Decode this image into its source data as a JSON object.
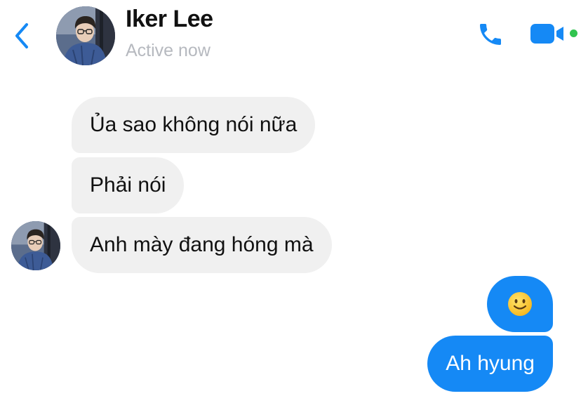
{
  "header": {
    "contact_name": "Iker Lee",
    "status": "Active now",
    "back_icon": "chevron-left-icon",
    "call_icon": "phone-icon",
    "video_icon": "video-camera-icon",
    "accent_color": "#1589f5",
    "active_indicator_color": "#31c44f"
  },
  "messages": [
    {
      "direction": "incoming",
      "text": "Ủa sao không nói nữa"
    },
    {
      "direction": "incoming",
      "text": "Phải nói"
    },
    {
      "direction": "incoming",
      "text": "Anh mày đang hóng mà"
    },
    {
      "direction": "outgoing",
      "emoji": "slightly-smiling-face-icon"
    },
    {
      "direction": "outgoing",
      "text": "Ah hyung"
    }
  ],
  "colors": {
    "incoming_bubble": "#f0f0f0",
    "outgoing_bubble": "#1589f5",
    "status_text": "#b6b9bf"
  }
}
